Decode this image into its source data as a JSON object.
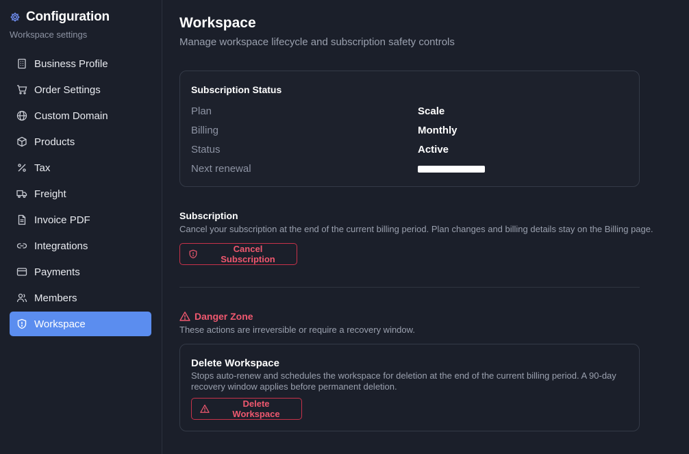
{
  "sidebar": {
    "title": "Configuration",
    "subtitle": "Workspace settings",
    "items": [
      {
        "label": "Business Profile",
        "icon": "building-icon"
      },
      {
        "label": "Order Settings",
        "icon": "cart-icon"
      },
      {
        "label": "Custom Domain",
        "icon": "globe-icon"
      },
      {
        "label": "Products",
        "icon": "box-icon"
      },
      {
        "label": "Tax",
        "icon": "percent-icon"
      },
      {
        "label": "Freight",
        "icon": "truck-icon"
      },
      {
        "label": "Invoice PDF",
        "icon": "document-icon"
      },
      {
        "label": "Integrations",
        "icon": "link-icon"
      },
      {
        "label": "Payments",
        "icon": "credit-card-icon"
      },
      {
        "label": "Members",
        "icon": "users-icon"
      },
      {
        "label": "Workspace",
        "icon": "shield-icon",
        "active": true
      }
    ]
  },
  "header": {
    "title": "Workspace",
    "subtitle": "Manage workspace lifecycle and subscription safety controls"
  },
  "subscription_status": {
    "title": "Subscription Status",
    "rows": [
      {
        "label": "Plan",
        "value": "Scale"
      },
      {
        "label": "Billing",
        "value": "Monthly"
      },
      {
        "label": "Status",
        "value": "Active"
      },
      {
        "label": "Next renewal",
        "value": ""
      }
    ]
  },
  "subscription": {
    "title": "Subscription",
    "description": "Cancel your subscription at the end of the current billing period. Plan changes and billing details stay on the Billing page.",
    "cancel_label": "Cancel Subscription"
  },
  "danger_zone": {
    "title": "Danger Zone",
    "description": "These actions are irreversible or require a recovery window.",
    "delete_title": "Delete Workspace",
    "delete_description": "Stops auto-renew and schedules the workspace for deletion at the end of the current billing period. A 90-day recovery window applies before permanent deletion.",
    "delete_label": "Delete Workspace"
  },
  "colors": {
    "accent": "#5b8def",
    "danger": "#f0586f",
    "background": "#1b1f2a"
  }
}
